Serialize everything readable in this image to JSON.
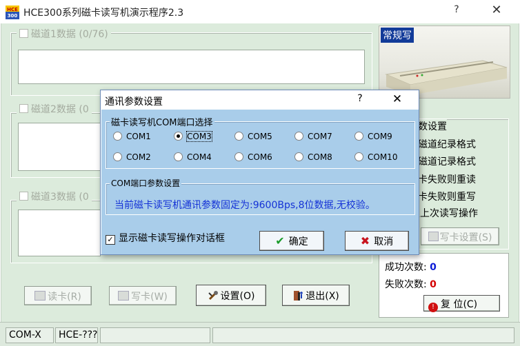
{
  "window": {
    "title": "HCE300系列磁卡读写机演示程序2.3",
    "help_glyph": "?",
    "close_glyph": "✕",
    "app_icon_text": "HCE 300"
  },
  "tracks": [
    {
      "label": "磁道1数据 (0/76)"
    },
    {
      "label": "磁道2数据 (0"
    },
    {
      "label": "磁道3数据 (0"
    }
  ],
  "buttons": {
    "read_card": "读卡(R)",
    "write_card": "写卡(W)",
    "settings": "设置(O)",
    "exit": "退出(X)",
    "write_settings": "写卡设置(S)",
    "reset": "复    位(C)"
  },
  "reader": {
    "mode_badge": "常规写"
  },
  "options": {
    "group_label": "数设置",
    "items": [
      "磁道纪录格式",
      "磁道记录格式",
      "卡失败则重读",
      "卡失败则重写",
      "复上次读写操作"
    ]
  },
  "counters": {
    "success_label": "成功次数:",
    "success_value": "0",
    "fail_label": "失败次数:",
    "fail_value": "0"
  },
  "status": {
    "port": "COM-X",
    "model": "HCE-???"
  },
  "dialog": {
    "title": "通讯参数设置",
    "help_glyph": "?",
    "close_glyph": "✕",
    "port_group_label": "磁卡读写机COM端口选择",
    "ports_row1": [
      "COM1",
      "COM3",
      "COM5",
      "COM7",
      "COM9"
    ],
    "ports_row2": [
      "COM2",
      "COM4",
      "COM6",
      "COM8",
      "COM10"
    ],
    "selected_port": "COM3",
    "param_group_label": "COM端口参数设置",
    "param_info": "当前磁卡读写机通讯参数固定为:9600Bps,8位数据,无校验。",
    "show_dialog_label": "显示磁卡读写操作对话框",
    "show_dialog_checked": true,
    "ok_label": "确定",
    "cancel_label": "取消"
  },
  "colors": {
    "client_bg": "#dcebdc",
    "dialog_bg": "#a9cdea",
    "info_text": "#1432d6",
    "success_value": "#0b1bd6",
    "fail_value": "#d40000",
    "badge_bg": "#123b99"
  },
  "icons": {
    "ok": "check-icon",
    "cancel": "x-icon",
    "settings": "tools-icon",
    "exit": "exit-door-icon",
    "read": "read-card-icon",
    "write": "write-card-icon",
    "reset": "reset-icon"
  }
}
